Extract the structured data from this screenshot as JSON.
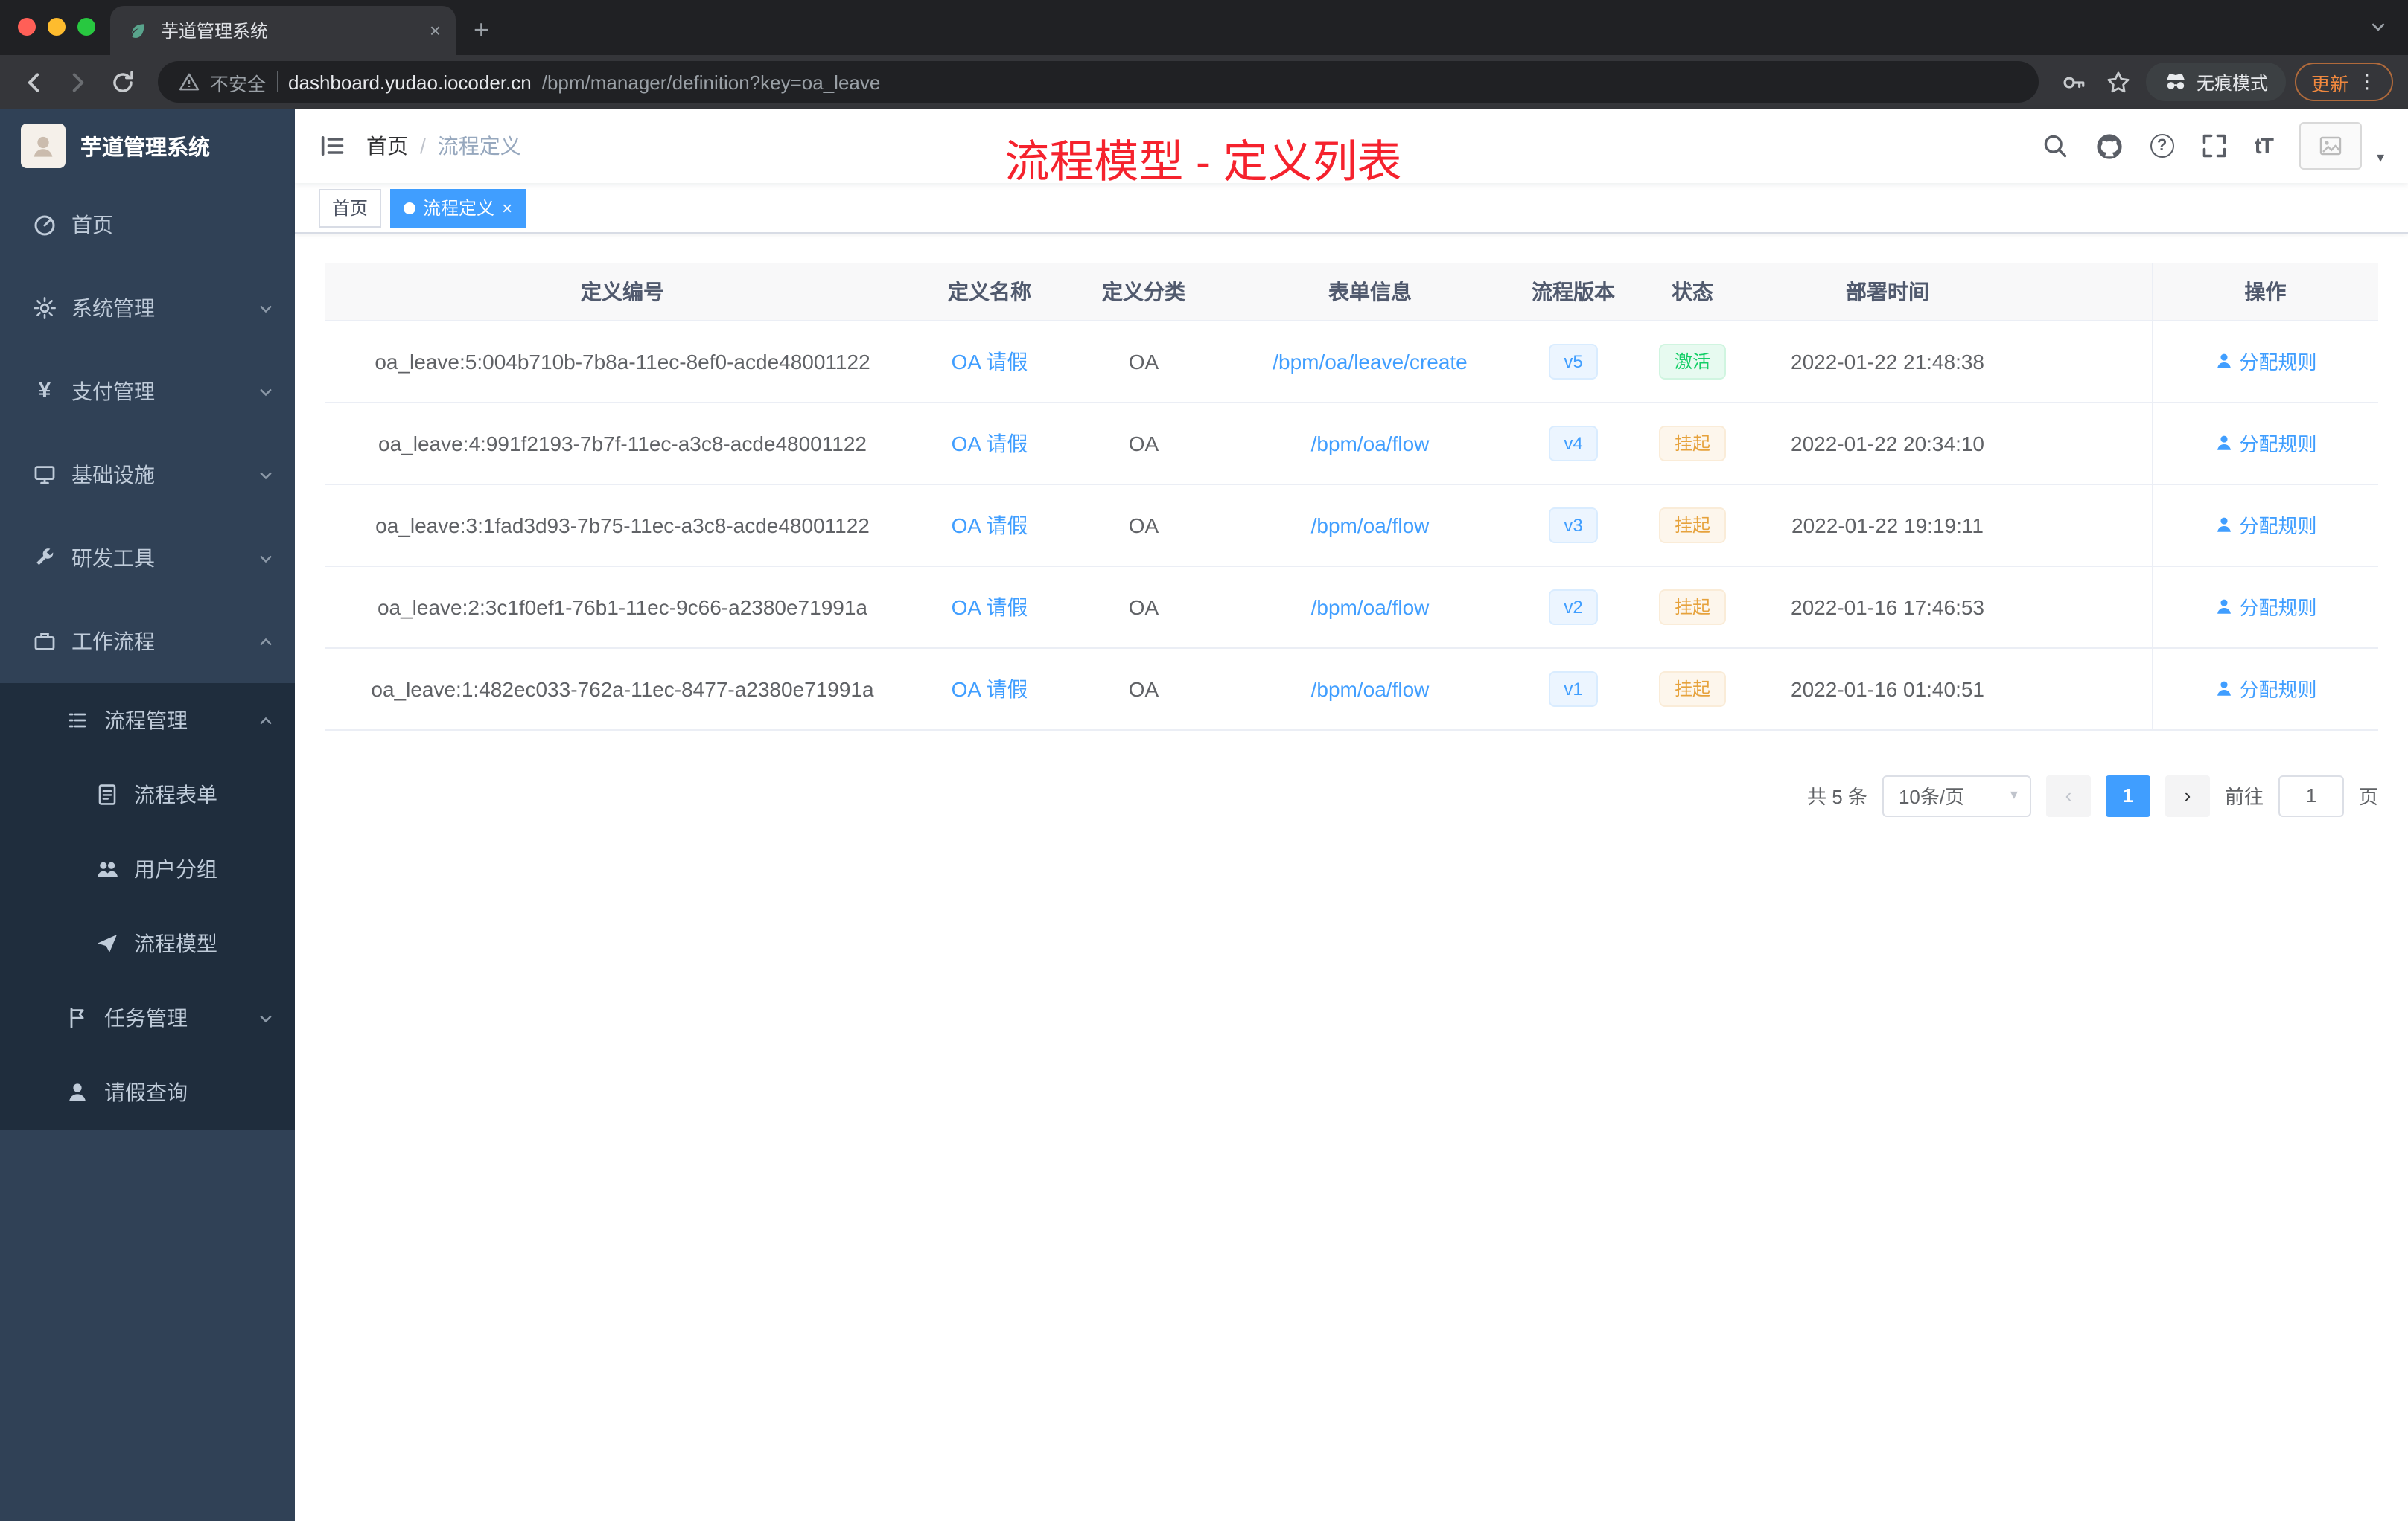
{
  "browser": {
    "tab": {
      "title": "芋道管理系统"
    },
    "toolbar": {
      "security_label": "不安全",
      "url_host": "dashboard.yudao.iocoder.cn",
      "url_path": "/bpm/manager/definition?key=oa_leave",
      "incognito_label": "无痕模式",
      "update_label": "更新"
    }
  },
  "sidebar": {
    "logo_title": "芋道管理系统",
    "items": {
      "home": "首页",
      "system": "系统管理",
      "payment": "支付管理",
      "infra": "基础设施",
      "devtools": "研发工具",
      "workflow": "工作流程",
      "process_mgmt": "流程管理",
      "process_form": "流程表单",
      "user_group": "用户分组",
      "process_model": "流程模型",
      "task_mgmt": "任务管理",
      "leave_query": "请假查询"
    }
  },
  "navbar": {
    "breadcrumb_home": "首页",
    "breadcrumb_separator": "/",
    "breadcrumb_current": "流程定义",
    "annotation": "流程模型 - 定义列表"
  },
  "tags": {
    "home": "首页",
    "active": "流程定义"
  },
  "table": {
    "columns": [
      "定义编号",
      "定义名称",
      "定义分类",
      "表单信息",
      "流程版本",
      "状态",
      "部署时间",
      "操作"
    ],
    "rows": [
      {
        "id": "oa_leave:5:004b710b-7b8a-11ec-8ef0-acde48001122",
        "name": "OA 请假",
        "category": "OA",
        "form": "/bpm/oa/leave/create",
        "version": "v5",
        "status": "激活",
        "time": "2022-01-22 21:48:38",
        "action": "分配规则"
      },
      {
        "id": "oa_leave:4:991f2193-7b7f-11ec-a3c8-acde48001122",
        "name": "OA 请假",
        "category": "OA",
        "form": "/bpm/oa/flow",
        "version": "v4",
        "status": "挂起",
        "time": "2022-01-22 20:34:10",
        "action": "分配规则"
      },
      {
        "id": "oa_leave:3:1fad3d93-7b75-11ec-a3c8-acde48001122",
        "name": "OA 请假",
        "category": "OA",
        "form": "/bpm/oa/flow",
        "version": "v3",
        "status": "挂起",
        "time": "2022-01-22 19:19:11",
        "action": "分配规则"
      },
      {
        "id": "oa_leave:2:3c1f0ef1-76b1-11ec-9c66-a2380e71991a",
        "name": "OA 请假",
        "category": "OA",
        "form": "/bpm/oa/flow",
        "version": "v2",
        "status": "挂起",
        "time": "2022-01-16 17:46:53",
        "action": "分配规则"
      },
      {
        "id": "oa_leave:1:482ec033-762a-11ec-8477-a2380e71991a",
        "name": "OA 请假",
        "category": "OA",
        "form": "/bpm/oa/flow",
        "version": "v1",
        "status": "挂起",
        "time": "2022-01-16 01:40:51",
        "action": "分配规则"
      }
    ]
  },
  "pagination": {
    "total": "共 5 条",
    "page_size": "10条/页",
    "page": "1",
    "goto_label": "前往",
    "goto_value": "1",
    "goto_suffix": "页"
  },
  "colors": {
    "accent_blue": "#409eff",
    "sidebar_bg": "#304156",
    "submenu_bg": "#1f2d3d",
    "annotation_red": "#f5222d",
    "status_active": "#13ce66",
    "status_suspended": "#e6a23c"
  }
}
